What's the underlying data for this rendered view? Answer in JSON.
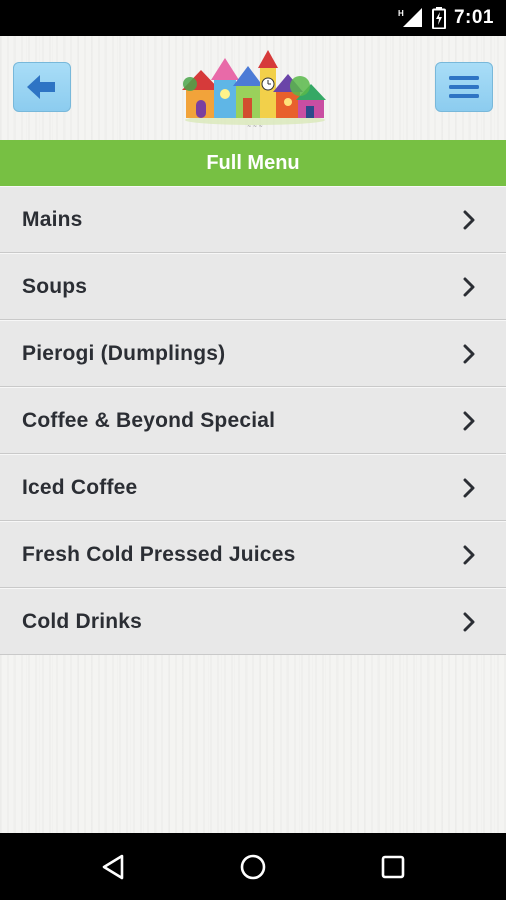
{
  "status_bar": {
    "time": "7:01",
    "icons": [
      "network-h-icon",
      "signal-icon",
      "battery-charging-icon"
    ]
  },
  "header": {
    "back_icon": "arrow-left-icon",
    "menu_icon": "hamburger-icon",
    "logo": "village-houses-logo"
  },
  "title_bar": {
    "title": "Full Menu"
  },
  "menu": {
    "items": [
      {
        "label": "Mains"
      },
      {
        "label": "Soups"
      },
      {
        "label": "Pierogi (Dumplings)"
      },
      {
        "label": "Coffee & Beyond Special"
      },
      {
        "label": "Iced Coffee"
      },
      {
        "label": "Fresh Cold Pressed Juices"
      },
      {
        "label": "Cold Drinks"
      }
    ]
  },
  "nav_bar": {
    "icons": [
      "back-triangle-icon",
      "home-circle-icon",
      "recents-square-icon"
    ]
  },
  "colors": {
    "accent_green": "#77c043",
    "button_blue": "#9fd6f3",
    "icon_blue": "#2e74c4",
    "item_bg": "#e8e8e8",
    "text_dark": "#2b2e34"
  }
}
